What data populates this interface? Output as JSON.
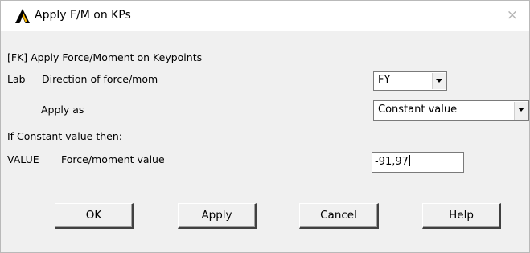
{
  "window": {
    "title": "Apply F/M on KPs",
    "close_glyph": "×",
    "icon": "ansys-logo-icon"
  },
  "form": {
    "header": "[FK]  Apply Force/Moment on Keypoints",
    "lab_key": "Lab",
    "lab_desc": "Direction of force/mom",
    "direction_value": "FY",
    "apply_as_label": "Apply as",
    "apply_as_value": "Constant value",
    "if_constant_label": "If Constant value then:",
    "value_key": "VALUE",
    "value_desc": "Force/moment value",
    "value_input": "-91,97"
  },
  "buttons": {
    "ok": "OK",
    "apply": "Apply",
    "cancel": "Cancel",
    "help": "Help"
  },
  "colors": {
    "logo_yellow": "#f7b500",
    "logo_black": "#000000",
    "background": "#f0f0f0"
  }
}
